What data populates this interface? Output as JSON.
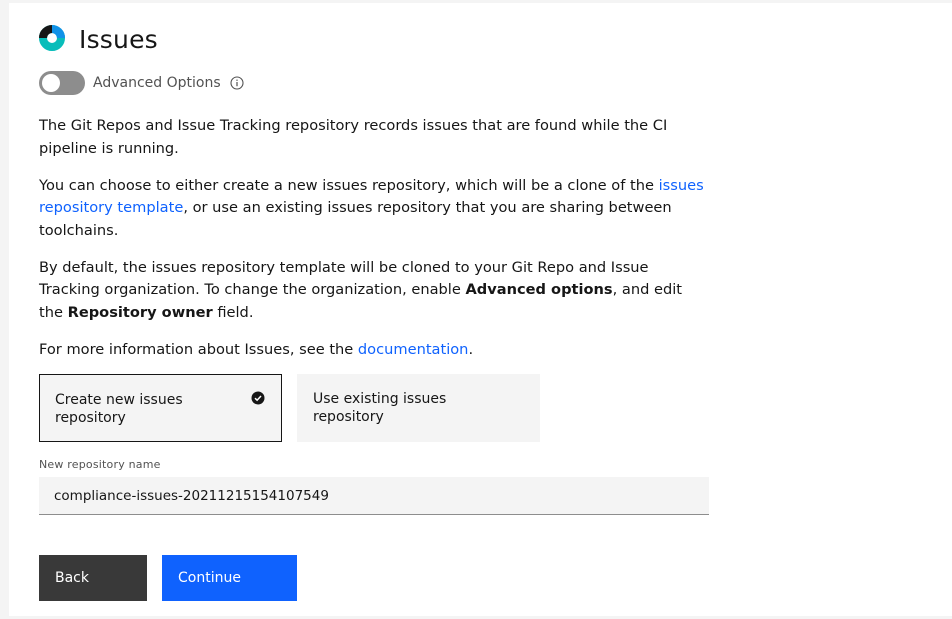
{
  "header": {
    "title": "Issues",
    "icon": "issues-ring-icon"
  },
  "advanced_options": {
    "label": "Advanced Options",
    "enabled": false,
    "info_icon": "info-icon"
  },
  "description": {
    "p1": "The Git Repos and Issue Tracking repository records issues that are found while the CI pipeline is running.",
    "p2_pre": "You can choose to either create a new issues repository, which will be a clone of the ",
    "p2_link": "issues repository template",
    "p2_post": ", or use an existing issues repository that you are sharing between toolchains.",
    "p3_a": "By default, the issues repository template will be cloned to your Git Repo and Issue Tracking organization. To change the organization, enable ",
    "p3_bold1": "Advanced options",
    "p3_b": ", and edit the ",
    "p3_bold2": "Repository owner",
    "p3_c": " field.",
    "p4_pre": "For more information about Issues, see the ",
    "p4_link": "documentation",
    "p4_post": "."
  },
  "tiles": [
    {
      "label": "Create new issues repository",
      "selected": true
    },
    {
      "label": "Use existing issues repository",
      "selected": false
    }
  ],
  "repo_name": {
    "label": "New repository name",
    "value": "compliance-issues-20211215154107549"
  },
  "buttons": {
    "back": "Back",
    "continue": "Continue"
  },
  "colors": {
    "primary": "#0f62fe",
    "secondary_button": "#393939",
    "logo_teal": "#1192e8",
    "logo_green": "#08bdba"
  }
}
